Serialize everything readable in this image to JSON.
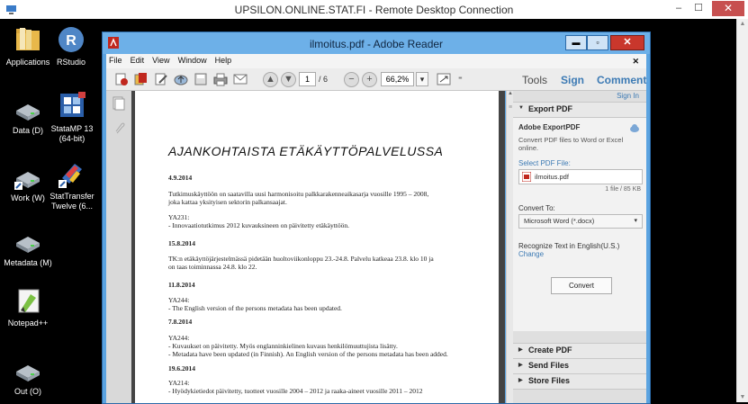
{
  "rdp": {
    "title": "UPSILON.ONLINE.STAT.FI - Remote Desktop Connection",
    "min": "–",
    "max": "☐",
    "close": "✕"
  },
  "desktop": {
    "icons": [
      {
        "label": "Applications"
      },
      {
        "label": "RStudio"
      },
      {
        "label": "Data (D)"
      },
      {
        "label": "StataMP 13 (64-bit)"
      },
      {
        "label": "Work (W)"
      },
      {
        "label": "StatTransfer Twelve (6..."
      },
      {
        "label": "Metadata (M)"
      },
      {
        "label": "Notepad++"
      },
      {
        "label": "Out (O)"
      }
    ]
  },
  "adobe": {
    "title": "ilmoitus.pdf - Adobe Reader",
    "menu": [
      "File",
      "Edit",
      "View",
      "Window",
      "Help"
    ],
    "menu_close": "✕",
    "page_current": "1",
    "page_total": "/ 6",
    "zoom": "66,2%",
    "tools": "Tools",
    "sign": "Sign",
    "comment": "Comment"
  },
  "document": {
    "heading": "AJANKOHTAISTA ETÄKÄYTTÖPALVELUSSA",
    "items": [
      {
        "date": "4.9.2014",
        "lines": [
          "Tutkimuskäyttöön on saatavilla uusi harmonisoitu palkkarakenneaikasarja vuosille 1995 – 2008,",
          "joka kattaa yksityisen sektorin palkansaajat."
        ],
        "sub": "YA231:",
        "sublines": [
          "- Innovaatiotutkimus 2012 kuvauksineen on päivitetty etäkäyttöön."
        ]
      },
      {
        "date": "15.8.2014",
        "lines": [
          "TK:n etäkäyttöjärjestelmässä pidetään huoltoviikonloppu 23.-24.8. Palvelu katkeaa 23.8. klo 10 ja",
          "on taas toiminnassa 24.8. klo 22."
        ]
      },
      {
        "date": "11.8.2014",
        "sub": "YA244:",
        "sublines": [
          "- The English version of the persons metadata has been updated."
        ]
      },
      {
        "date": "7.8.2014",
        "sub": "YA244:",
        "sublines": [
          "- Kuvaukset on päivitetty. Myös englanninkielinen kuvaus henkilömuuttujista lisätty.",
          "- Metadata have been updated (in Finnish). An English version of the persons metadata has been added."
        ]
      },
      {
        "date": "19.6.2014",
        "sub": "YA214:",
        "sublines": [
          "- Hyödykietiedot päivitetty, tuotteet vuosille 2004 – 2012 ja raaka-aineet vuosille 2011 – 2012"
        ]
      }
    ]
  },
  "panel": {
    "sign_in": "Sign In",
    "export_pdf": "Export PDF",
    "service": "Adobe ExportPDF",
    "service_desc": "Convert PDF files to Word or Excel online.",
    "select_label": "Select PDF File:",
    "file_name": "ilmoitus.pdf",
    "file_count": "1 file / 85 KB",
    "convert_to": "Convert To:",
    "format": "Microsoft Word (*.docx)",
    "recognize": "Recognize Text in English(U.S.)",
    "change": "Change",
    "convert": "Convert",
    "create_pdf": "Create PDF",
    "send_files": "Send Files",
    "store_files": "Store Files"
  }
}
